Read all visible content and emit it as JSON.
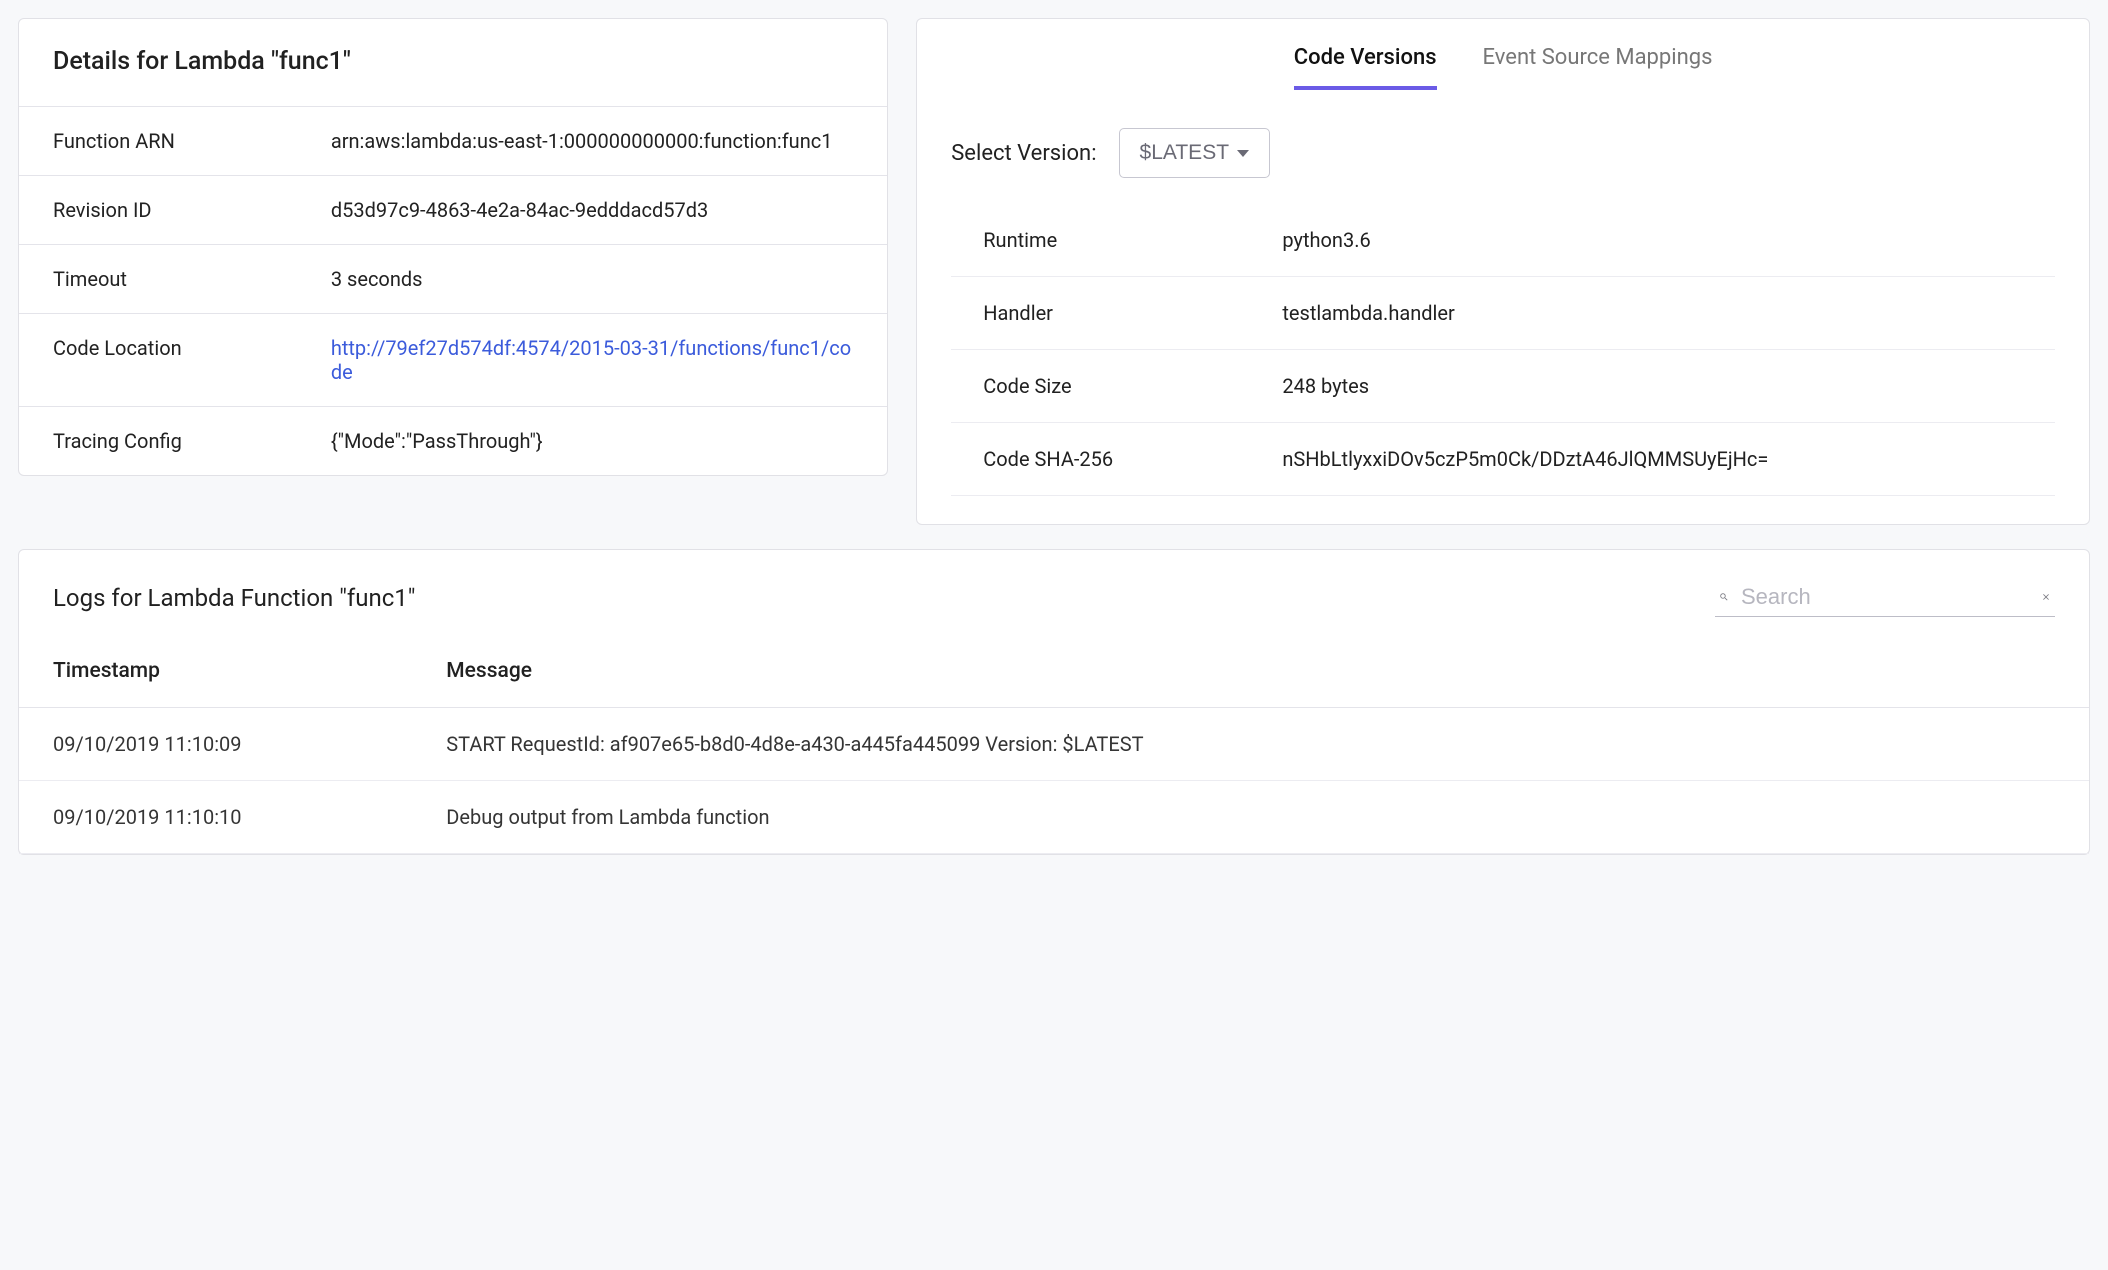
{
  "details": {
    "title": "Details for Lambda \"func1\"",
    "rows": [
      {
        "label": "Function ARN",
        "value": "arn:aws:lambda:us-east-1:000000000000:function:func1",
        "link": false
      },
      {
        "label": "Revision ID",
        "value": "d53d97c9-4863-4e2a-84ac-9edddacd57d3",
        "link": false
      },
      {
        "label": "Timeout",
        "value": "3 seconds",
        "link": false
      },
      {
        "label": "Code Location",
        "value": "http://79ef27d574df:4574/2015-03-31/functions/func1/code",
        "link": true
      },
      {
        "label": "Tracing Config",
        "value": "{\"Mode\":\"PassThrough\"}",
        "link": false
      }
    ]
  },
  "versions": {
    "tabs": [
      {
        "label": "Code Versions",
        "active": true
      },
      {
        "label": "Event Source Mappings",
        "active": false
      }
    ],
    "select_label": "Select Version:",
    "selected_version": "$LATEST",
    "kv": [
      {
        "k": "Runtime",
        "v": "python3.6"
      },
      {
        "k": "Handler",
        "v": "testlambda.handler"
      },
      {
        "k": "Code Size",
        "v": "248 bytes"
      },
      {
        "k": "Code SHA-256",
        "v": "nSHbLtlyxxiDOv5czP5m0Ck/DDztA46JlQMMSUyEjHc="
      }
    ]
  },
  "logs": {
    "title": "Logs for Lambda Function \"func1\"",
    "search_placeholder": "Search",
    "columns": {
      "timestamp": "Timestamp",
      "message": "Message"
    },
    "rows": [
      {
        "ts": "09/10/2019 11:10:09",
        "msg": "START RequestId: af907e65-b8d0-4d8e-a430-a445fa445099 Version: $LATEST"
      },
      {
        "ts": "09/10/2019 11:10:10",
        "msg": "Debug output from Lambda function"
      }
    ]
  }
}
